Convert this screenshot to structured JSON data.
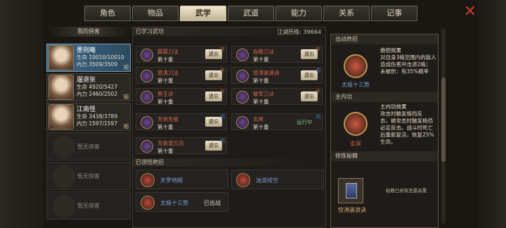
{
  "tabs": [
    "角色",
    "物品",
    "武学",
    "武道",
    "能力",
    "关系",
    "记事"
  ],
  "active_tab": "武学",
  "left": {
    "title": "我的侠客",
    "heroes": [
      {
        "name": "墨则曦",
        "hp": "生命 10010/10010",
        "mp": "内力 3509/3509",
        "flag": "阳"
      },
      {
        "name": "遛退张",
        "hp": "生命 4920/5427",
        "mp": "内力 2460/2502",
        "flag": "阳"
      },
      {
        "name": "江南怪",
        "hp": "生命 3438/3789",
        "mp": "内力 1597/1597",
        "flag": "阳"
      }
    ],
    "empty": [
      "暂无侠客",
      "暂无侠客",
      "暂无侠客"
    ]
  },
  "mid": {
    "learned_title": "已学习武功",
    "points": "江湖历练: 39664",
    "skills": [
      {
        "name": "霹雳刀法",
        "level": "第十重",
        "button": "遗忘",
        "tag": "外"
      },
      {
        "name": "吞鲸刀法",
        "level": "第十重",
        "button": "遗忘",
        "tag": "外"
      },
      {
        "name": "怒涛刀法",
        "level": "第十重",
        "button": "遗忘",
        "tag": "外"
      },
      {
        "name": "惊涛骇浪诀",
        "level": "第十重",
        "button": "遗忘",
        "tag": "内"
      },
      {
        "name": "兽王诀",
        "level": "第十重",
        "button": "遗忘",
        "tag": "外"
      },
      {
        "name": "破军刀法",
        "level": "第十重",
        "button": "遗忘",
        "tag": "外"
      },
      {
        "name": "天地无极",
        "level": "第十重",
        "button": "遗忘",
        "tag": "内"
      },
      {
        "name": "玄冥",
        "level": "第十重",
        "status": "运行中",
        "tag": "内"
      },
      {
        "name": "无极混元功",
        "level": "第十重",
        "button": "遗忘",
        "tag": "内"
      }
    ],
    "ult_title": "已领悟绝招",
    "ults": [
      {
        "name": "天罗地网",
        "status": ""
      },
      {
        "name": "浊浪排空",
        "status": ""
      },
      {
        "name": "太极十三势",
        "status": "已出战"
      }
    ]
  },
  "right": {
    "ult_header": "出战绝招",
    "ult_name": "太极十三势",
    "ult_effect_title": "绝招效果",
    "ult_effect": "对自身3格范围内的敌人造成伤害并击退2格；",
    "ult_extra": "未被防：有35%概率",
    "inner_header": "主内功",
    "inner_name": "玄冥",
    "inner_effect_title": "主内功效果",
    "inner_effect": "击，被攻击时触发格挡必定反击。战斗时死亡后重新复活，恢复25%生命。",
    "inner_top": "攻击时触发格挡反",
    "train_header": "修炼秘籍",
    "train_name": "惊涛骇浪诀",
    "train_note": "秘籍已修炼至最高重"
  }
}
